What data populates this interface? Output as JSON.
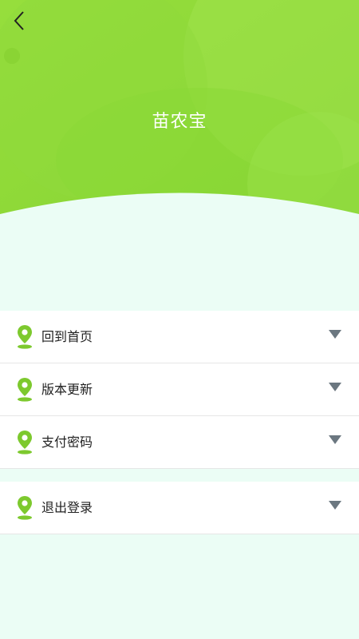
{
  "header": {
    "title": "苗农宝",
    "back_icon": "chevron-left-icon"
  },
  "colors": {
    "header_green": "#8fdc3a",
    "header_green_light": "#a6e65a",
    "background": "#ebfdf5",
    "pin_green": "#7dc92e",
    "chevron_gray": "#6b7780"
  },
  "menu": {
    "items": [
      {
        "label": "回到首页",
        "icon": "location-pin-icon"
      },
      {
        "label": "版本更新",
        "icon": "location-pin-icon"
      },
      {
        "label": "支付密码",
        "icon": "location-pin-icon"
      }
    ],
    "logout": {
      "label": "退出登录",
      "icon": "location-pin-icon"
    }
  }
}
